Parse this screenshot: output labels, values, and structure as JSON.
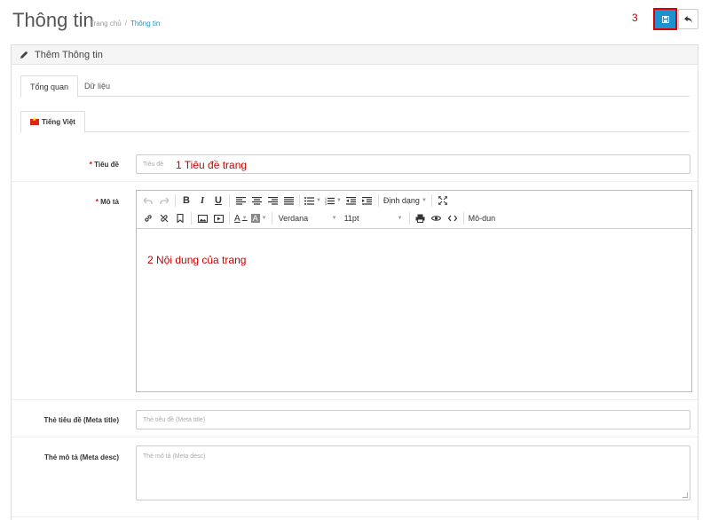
{
  "header": {
    "title": "Thông tin",
    "breadcrumb": [
      "Trang chủ",
      "Thông tin"
    ],
    "step3": "3"
  },
  "panel": {
    "heading": "Thêm Thông tin"
  },
  "tabs": [
    "Tổng quan",
    "Dữ liệu"
  ],
  "language_tab": "Tiếng Việt",
  "form": {
    "title_label": "Tiêu đề",
    "title_placeholder": "Tiêu đề",
    "title_annotation": "1  Tiêu đề trang",
    "desc_label": "Mô tả",
    "editor_annotation": "2  Nội dung của trang",
    "meta_title_label": "Thẻ tiêu đề (Meta title)",
    "meta_title_placeholder": "Thẻ tiêu đề (Meta title)",
    "meta_desc_label": "Thẻ mô tả (Meta desc)",
    "meta_desc_placeholder": "Thẻ mô tả (Meta desc)",
    "required_mark": "*"
  },
  "editor": {
    "format_label": "Định dạng",
    "font_family": "Verdana",
    "font_size": "11pt",
    "module_label": "Mô-dun",
    "bold": "B",
    "italic": "I",
    "underline": "U",
    "font_color": "A",
    "bg_color": "A"
  },
  "colors": {
    "primary": "#1e91cf",
    "highlight": "#dd0000",
    "annotation": "#cc0000"
  }
}
